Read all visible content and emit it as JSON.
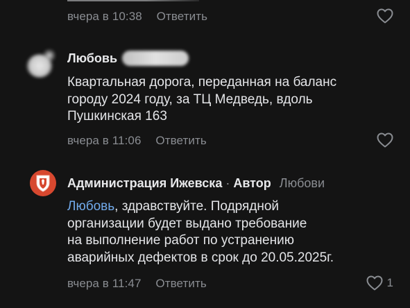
{
  "colors": {
    "background": "#141414",
    "text": "#e4e5e8",
    "muted": "#8a8d92",
    "mention": "#71aaeb",
    "admin_avatar": "#d7482f"
  },
  "comments": [
    {
      "time": "вчера в 10:38",
      "reply_label": "Ответить",
      "like_icon": "heart-outline-icon",
      "like_count": ""
    },
    {
      "author": "Любовь",
      "avatar_icon": "blurred-avatar",
      "text_lines": [
        "Квартальная дорога, переданная на баланс",
        "городу 2024 году, за ТЦ Медведь, вдоль",
        "Пушкинская 163"
      ],
      "time": "вчера в 11:06",
      "reply_label": "Ответить",
      "like_icon": "heart-outline-icon",
      "like_count": ""
    },
    {
      "author": "Администрация Ижевска",
      "separator": "·",
      "role": "Автор",
      "reply_to": "Любови",
      "avatar_icon": "city-coat-of-arms-icon",
      "mention": "Любовь",
      "text_lines": [
        ", здравствуйте. Подрядной",
        "организации будет выдано требование",
        "на выполнение работ по устранению",
        "аварийных дефектов в срок до 20.05.2025г."
      ],
      "time": "вчера в 11:47",
      "reply_label": "Ответить",
      "like_icon": "heart-outline-icon",
      "like_count": "1"
    }
  ]
}
